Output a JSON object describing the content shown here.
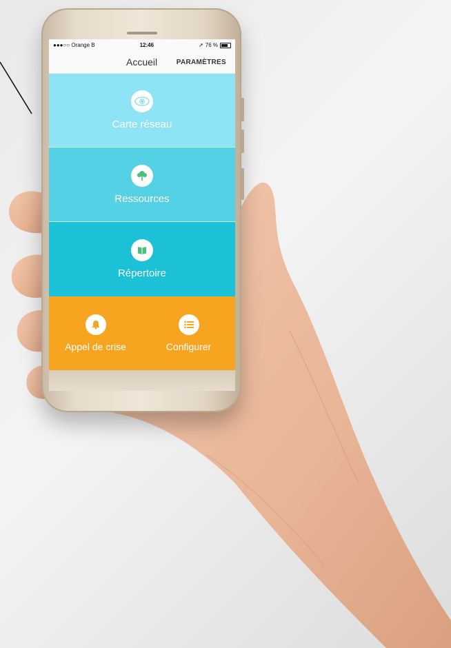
{
  "status_bar": {
    "carrier": "●●●○○ Orange B",
    "time": "12:46",
    "battery": "76 %"
  },
  "nav": {
    "title": "Accueil",
    "action": "PARAMÈTRES"
  },
  "tiles": [
    {
      "label": "Carte réseau",
      "icon": "eye-icon",
      "color": "#8ee3f5"
    },
    {
      "label": "Ressources",
      "icon": "tree-icon",
      "color": "#55d1e6"
    },
    {
      "label": "Répertoire",
      "icon": "book-icon",
      "color": "#1cc1d8"
    }
  ],
  "bottom_actions": [
    {
      "label": "Appel de crise",
      "icon": "bell-icon"
    },
    {
      "label": "Configurer",
      "icon": "list-icon"
    }
  ],
  "colors": {
    "accent_orange": "#f7a521",
    "icon_green": "#4cbf7a"
  }
}
